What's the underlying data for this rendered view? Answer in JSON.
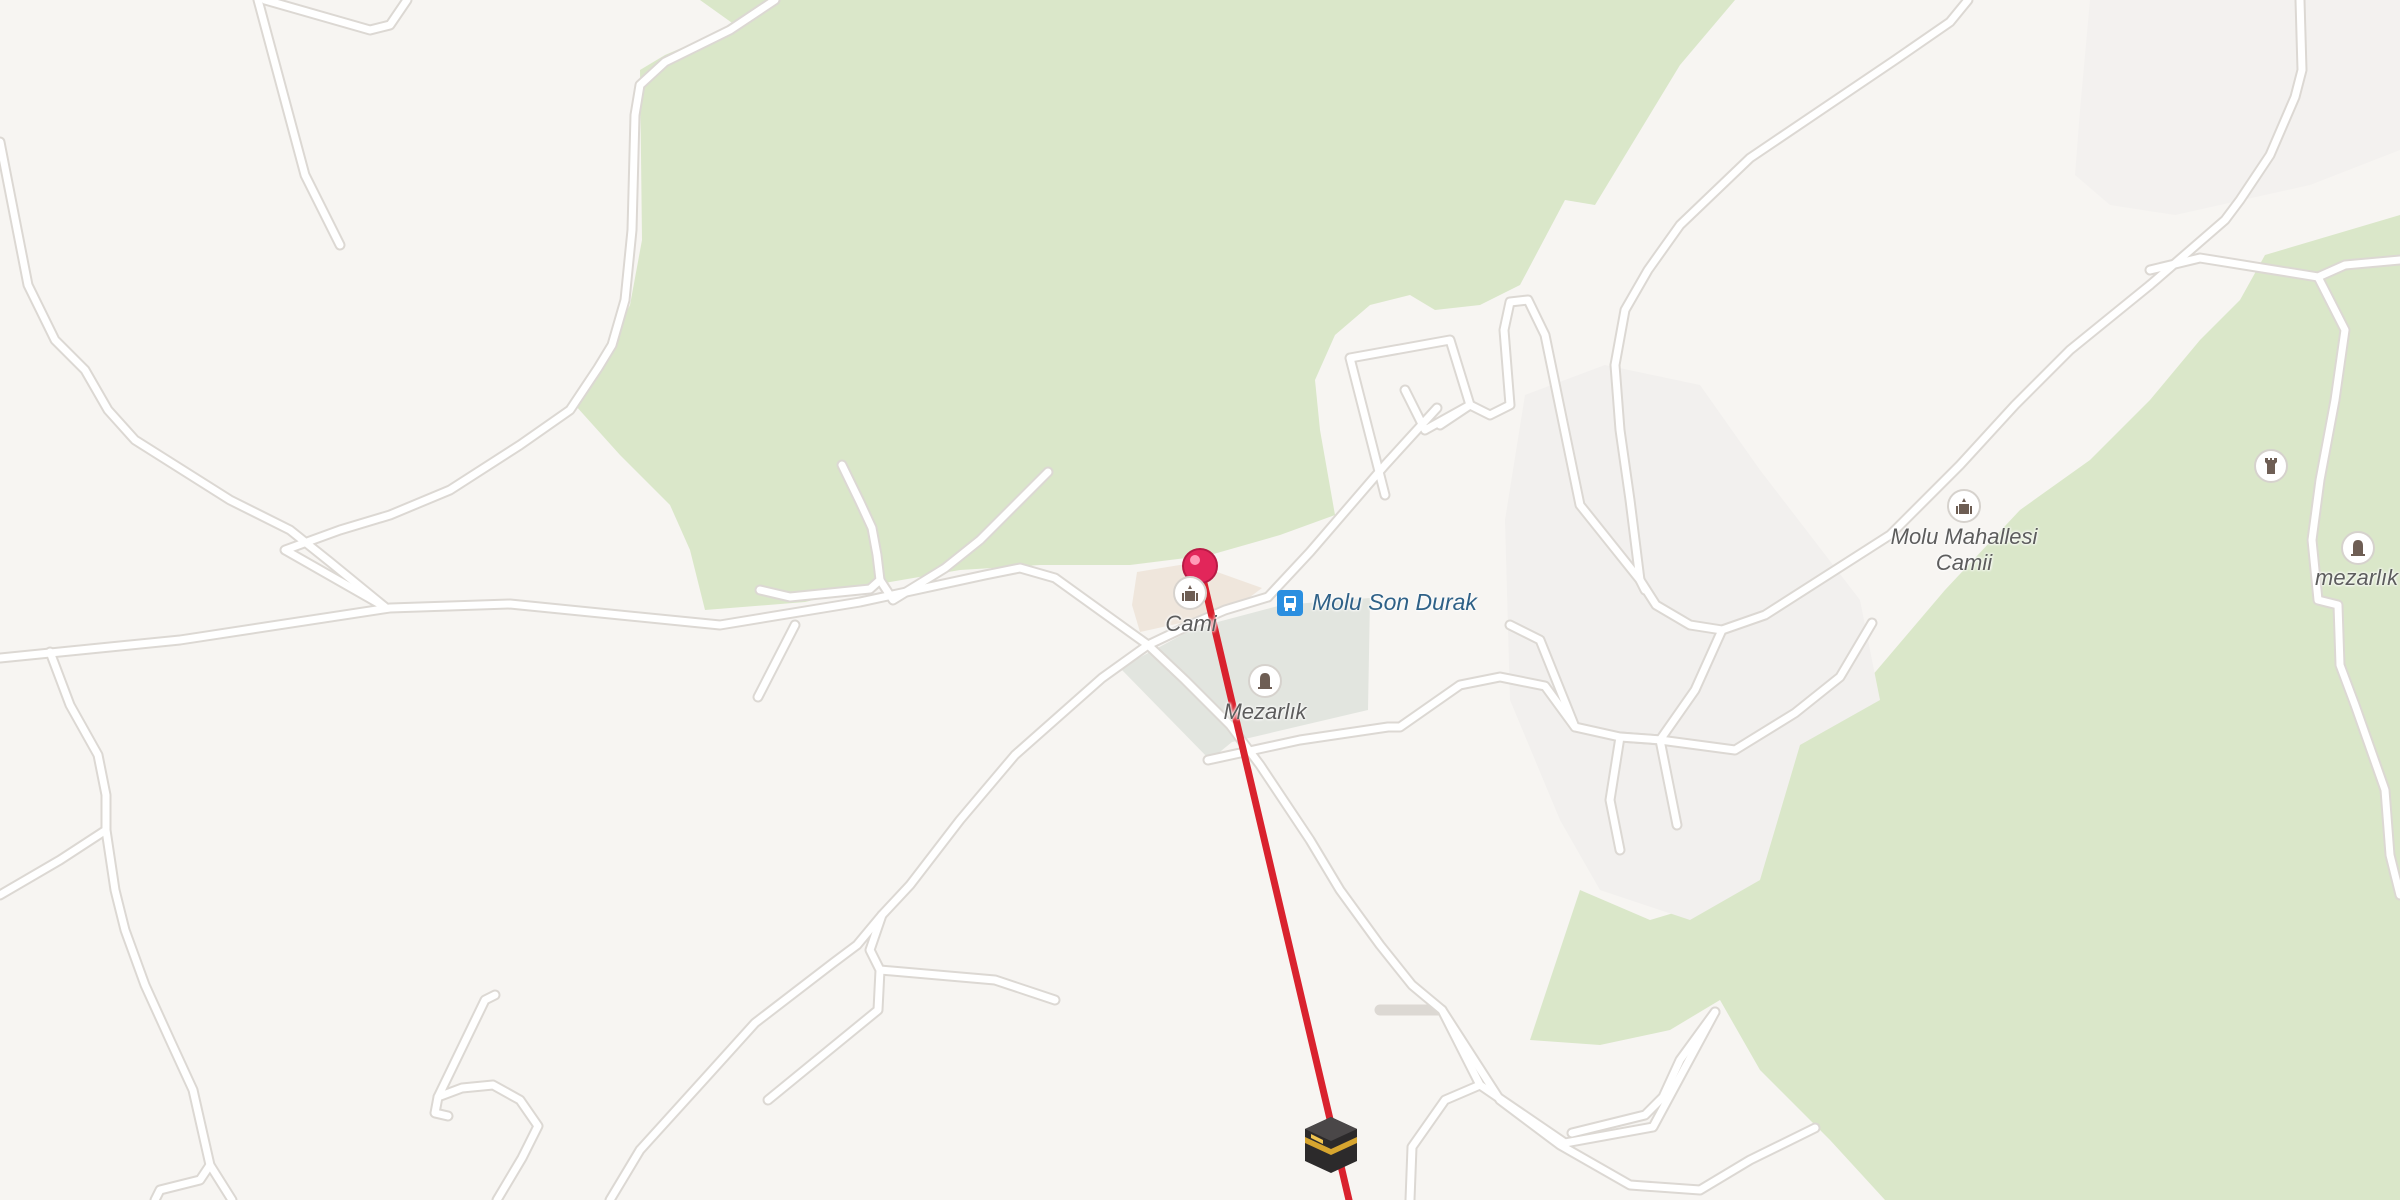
{
  "map": {
    "colors": {
      "background": "#f7f5f2",
      "forest": "#dae7c9",
      "cemetery": "#e2e5df",
      "road": "#ffffff",
      "route_line": "#d9222e",
      "pin": "#e2265a"
    },
    "labels": {
      "cami": "Cami",
      "molu_son_durak": "Molu Son Durak",
      "mezarlik": "Mezarlık",
      "molu_mahallesi_camii_line1": "Molu Mahallesi",
      "molu_mahallesi_camii_line2": "Camii",
      "mezarlik_right": "mezarlık"
    },
    "icons": {
      "mosque": "mosque-icon",
      "bus_stop": "bus-stop-icon",
      "cemetery": "cemetery-icon",
      "tower": "tower-icon",
      "kaaba": "kaaba-icon",
      "location_pin": "map-pin-icon"
    }
  }
}
